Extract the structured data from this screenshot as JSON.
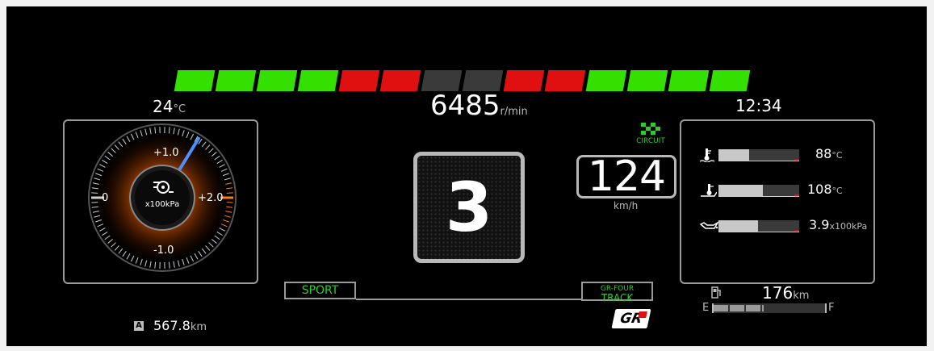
{
  "tach": {
    "segment_colors": [
      "#33e000",
      "#33e000",
      "#33e000",
      "#33e000",
      "#e01010",
      "#e01010",
      "#3a3a3a",
      "#3a3a3a",
      "#e01010",
      "#e01010",
      "#33e000",
      "#33e000",
      "#33e000",
      "#33e000"
    ],
    "rpm": "6485",
    "rpm_unit": "r/min"
  },
  "outside_temp": {
    "value": "24",
    "unit": "°C"
  },
  "clock": "12:34",
  "boost_gauge": {
    "unit": "x100kPa",
    "tick_top": "+1.0",
    "tick_left": "0",
    "tick_right": "+2.0",
    "tick_bottom": "-1.0",
    "needle_value": 1.35
  },
  "gear": "3",
  "drive_mode_badge": "CIRCUIT",
  "speed": {
    "value": "124",
    "unit": "km/h"
  },
  "indicators": [
    {
      "icon": "coolant-temp-icon",
      "fill": 0.38,
      "value": "88",
      "unit": "°C"
    },
    {
      "icon": "oil-temp-icon",
      "fill": 0.55,
      "value": "108",
      "unit": "°C"
    },
    {
      "icon": "oil-pressure-icon",
      "fill": 0.49,
      "value": "3.9",
      "unit": "x100kPa"
    }
  ],
  "drive_mode": "SPORT",
  "awd_mode": {
    "line1": "GR-FOUR",
    "line2": "TRACK"
  },
  "brand_logo": "GR",
  "range": {
    "value": "176",
    "unit": "km"
  },
  "fuel": {
    "empty_label": "E",
    "full_label": "F",
    "level": 0.45
  },
  "trip": {
    "label": "A",
    "value": "567.8",
    "unit": "km"
  }
}
